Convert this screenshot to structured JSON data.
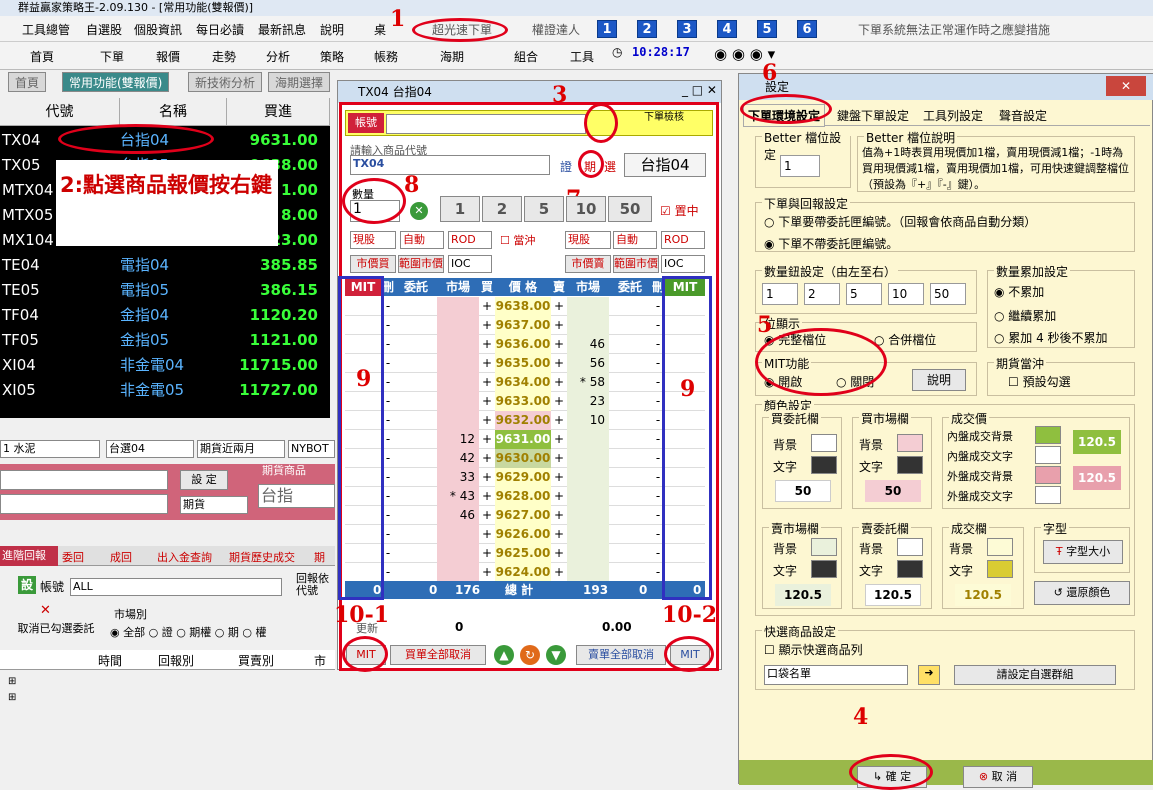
{
  "app": {
    "title": "群益贏家策略王-2.09.130 - [常用功能(雙報價)]"
  },
  "menu": [
    "工具總管",
    "自選股",
    "個股資訊",
    "每日必讀",
    "最新訊息",
    "說明",
    "桌"
  ],
  "menu_right": {
    "fast": "超光速下單",
    "master": "權證達人",
    "nums": [
      "1",
      "2",
      "3",
      "4",
      "5",
      "6"
    ],
    "notice": "下單系統無法正常運作時之應變措施"
  },
  "toolbar": {
    "items": [
      "首頁",
      "下單",
      "報價",
      "走勢",
      "分析",
      "策略",
      "帳務",
      "海期",
      "組合",
      "工具"
    ],
    "time": "10:28:17"
  },
  "tabs": [
    "首頁",
    "常用功能(雙報價)",
    "新技術分析",
    "海期選擇"
  ],
  "quote": {
    "headers": [
      "代號",
      "名稱",
      "買進"
    ],
    "rows": [
      [
        "TX04",
        "台指04",
        "9631.00"
      ],
      [
        "TX05",
        "台指05",
        "9638.00"
      ],
      [
        "MTX04",
        "",
        "1.00"
      ],
      [
        "MTX05",
        "",
        "8.00"
      ],
      [
        "MX104",
        "",
        "23.00"
      ],
      [
        "TE04",
        "電指04",
        "385.85"
      ],
      [
        "TE05",
        "電指05",
        "386.15"
      ],
      [
        "TF04",
        "金指04",
        "1120.20"
      ],
      [
        "TF05",
        "金指05",
        "1121.00"
      ],
      [
        "XI04",
        "非金電04",
        "11715.00"
      ],
      [
        "XI05",
        "非金電05",
        "11727.00"
      ]
    ]
  },
  "note": "2:點選商品報價按右鍵",
  "annotations": [
    "1",
    "3",
    "4",
    "5",
    "6",
    "7",
    "8",
    "9",
    "9",
    "10-1",
    "10-2"
  ],
  "lower": {
    "sel1": "1 水泥",
    "sel2": "台選04",
    "sel3": "期貨近兩月",
    "sel4": "NYBOT",
    "set": "設 定",
    "product_label": "期貨商品",
    "product": "台指",
    "type": "期貨",
    "tabs": [
      "進階回報",
      "委回",
      "成回",
      "出入金查詢",
      "期貨歷史成交",
      "期"
    ],
    "account_label": "帳號",
    "account": "ALL",
    "report": "回報依代號",
    "market_label": "市場別",
    "cancel": "取消已勾選委託",
    "markets": [
      "全部",
      "證",
      "期權",
      "期",
      "權"
    ],
    "cols": [
      "時間",
      "回報別",
      "買賣別",
      "市"
    ]
  },
  "order": {
    "title": "TX04 台指04",
    "account": "帳號",
    "check": "下單檢核",
    "prompt": "請輸入商品代號",
    "code": "TX04",
    "name": "台指04",
    "stock": "證",
    "fut": "期",
    "opt": "選",
    "qty_label": "數量",
    "qty": "1",
    "qtys": [
      "1",
      "2",
      "5",
      "10",
      "50"
    ],
    "center": "置中",
    "l": [
      "現股",
      "自動",
      "ROD",
      "當沖"
    ],
    "r": [
      "現股",
      "自動",
      "ROD"
    ],
    "mp": [
      "市價買",
      "範圍市價",
      "IOC"
    ],
    "mp2": [
      "市價賣",
      "範圍市價",
      "IOC"
    ],
    "heads": [
      "MIT",
      "刪",
      "委託",
      "市場",
      "買",
      "價 格",
      "賣",
      "市場",
      "委託",
      "刪",
      "MIT"
    ],
    "rows": [
      [
        "",
        "",
        "+",
        "9638.00",
        "+",
        "",
        ""
      ],
      [
        "",
        "",
        "+",
        "9637.00",
        "+",
        "",
        ""
      ],
      [
        "",
        "",
        "+",
        "9636.00",
        "+",
        "46",
        ""
      ],
      [
        "",
        "",
        "+",
        "9635.00",
        "+",
        "56",
        ""
      ],
      [
        "",
        "",
        "+",
        "9634.00",
        "+",
        "* 58",
        ""
      ],
      [
        "",
        "",
        "+",
        "9633.00",
        "+",
        "23",
        ""
      ],
      [
        "",
        "",
        "+",
        "9632.00",
        "+",
        "10",
        ""
      ],
      [
        "",
        "12",
        "+",
        "9631.00",
        "+",
        "",
        ""
      ],
      [
        "",
        "42",
        "+",
        "9630.00",
        "+",
        "",
        ""
      ],
      [
        "",
        "33",
        "+",
        "9629.00",
        "+",
        "",
        ""
      ],
      [
        "",
        "* 43",
        "+",
        "9628.00",
        "+",
        "",
        ""
      ],
      [
        "",
        "46",
        "+",
        "9627.00",
        "+",
        "",
        ""
      ],
      [
        "",
        "",
        "+",
        "9626.00",
        "+",
        "",
        ""
      ],
      [
        "",
        "",
        "+",
        "9625.00",
        "+",
        "",
        ""
      ],
      [
        "",
        "",
        "+",
        "9624.00",
        "+",
        "",
        ""
      ]
    ],
    "total": {
      "l0": "0",
      "l1": "0",
      "l2": "176",
      "label": "總 計",
      "r2": "193",
      "r1": "0",
      "r0": "0"
    },
    "bottom": {
      "upd": "更新",
      "v1": "0",
      "v2": "0.00"
    },
    "btns": [
      "MIT",
      "買單全部取消",
      "賣單全部取消",
      "MIT"
    ]
  },
  "settings": {
    "title": "設定",
    "tabs": [
      "下單環境設定",
      "鍵盤下單設定",
      "工具列設定",
      "聲音設定"
    ],
    "better_label": "Better 檔位設定",
    "better": "1",
    "better_desc_label": "Better 檔位說明",
    "better_desc": "值為+1時表買用現價加1檔，賣用現價減1檔；-1時為買用現價減1檔，賣用現價加1檔，可用快速鍵調整檔位（預設為『+』『-』鍵）。",
    "report_label": "下單與回報設定",
    "report1": "下單要帶委託匣編號。（回報會依商品自動分類）",
    "report2": "下單不帶委託匣編號。",
    "qtybtn_label": "數量鈕設定（由左至右）",
    "qtybtn": [
      "1",
      "2",
      "5",
      "10",
      "50"
    ],
    "acc_label": "數量累加設定",
    "acc": [
      "不累加",
      "繼續累加",
      "累加 4 秒後不累加"
    ],
    "pos_label": "位顯示",
    "pos": [
      "完整檔位",
      "合併檔位"
    ],
    "mit_label": "MIT功能",
    "mit": [
      "開啟",
      "關閉"
    ],
    "mit_btn": "說明",
    "dt_label": "期貨當沖",
    "dt": "預設勾選",
    "color_label": "顏色設定",
    "bg": "背景",
    "fg": "文字",
    "buy_ord": "買委託欄",
    "buy_mkt": "買市場欄",
    "deal": "成交價",
    "deal_items": [
      "內盤成交背景",
      "內盤成交文字",
      "外盤成交背景",
      "外盤成交文字"
    ],
    "v50": "50",
    "v1205": "120.5",
    "sell_mkt": "賣市場欄",
    "sell_ord": "賣委託欄",
    "deal2": "成交欄",
    "font_label": "字型",
    "font": "字型大小",
    "restore": "還原顏色",
    "quick_label": "快選商品設定",
    "quick": "顯示快選商品列",
    "pocket": "口袋名單",
    "group": "請設定自選群組",
    "ok": "確 定",
    "cancel": "取 消"
  },
  "colors": {
    "green": "#8fbf3f",
    "pink": "#f4cdd3",
    "yellow": "#d9cc33",
    "red": "#e0001a"
  }
}
